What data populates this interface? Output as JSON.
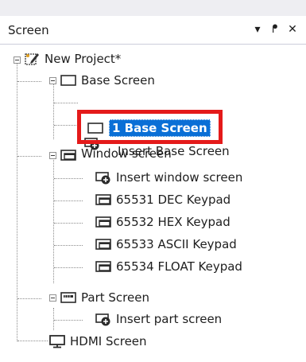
{
  "panel": {
    "title": "Screen",
    "buttons": {
      "dropdown": "▾",
      "pin": "ᖰ",
      "close": "✕"
    }
  },
  "tree": {
    "root": "New Project*",
    "base_screen": "Base Screen",
    "insert_base_screen": "Insert Base Screen",
    "base_screen_1": "1 Base Screen",
    "window_screen": "Window screen",
    "insert_window_screen": "Insert window screen",
    "keypad_dec": "65531 DEC Keypad",
    "keypad_hex": "65532 HEX Keypad",
    "keypad_ascii": "65533 ASCII Keypad",
    "keypad_float": "65534 FLOAT Keypad",
    "part_screen": "Part Screen",
    "insert_part_screen": "Insert part screen",
    "hdmi_screen": "HDMI Screen"
  },
  "colors": {
    "selection": "#0a6fd6",
    "highlight_border": "#e41a1a",
    "header_bg": "#eeeef2"
  }
}
